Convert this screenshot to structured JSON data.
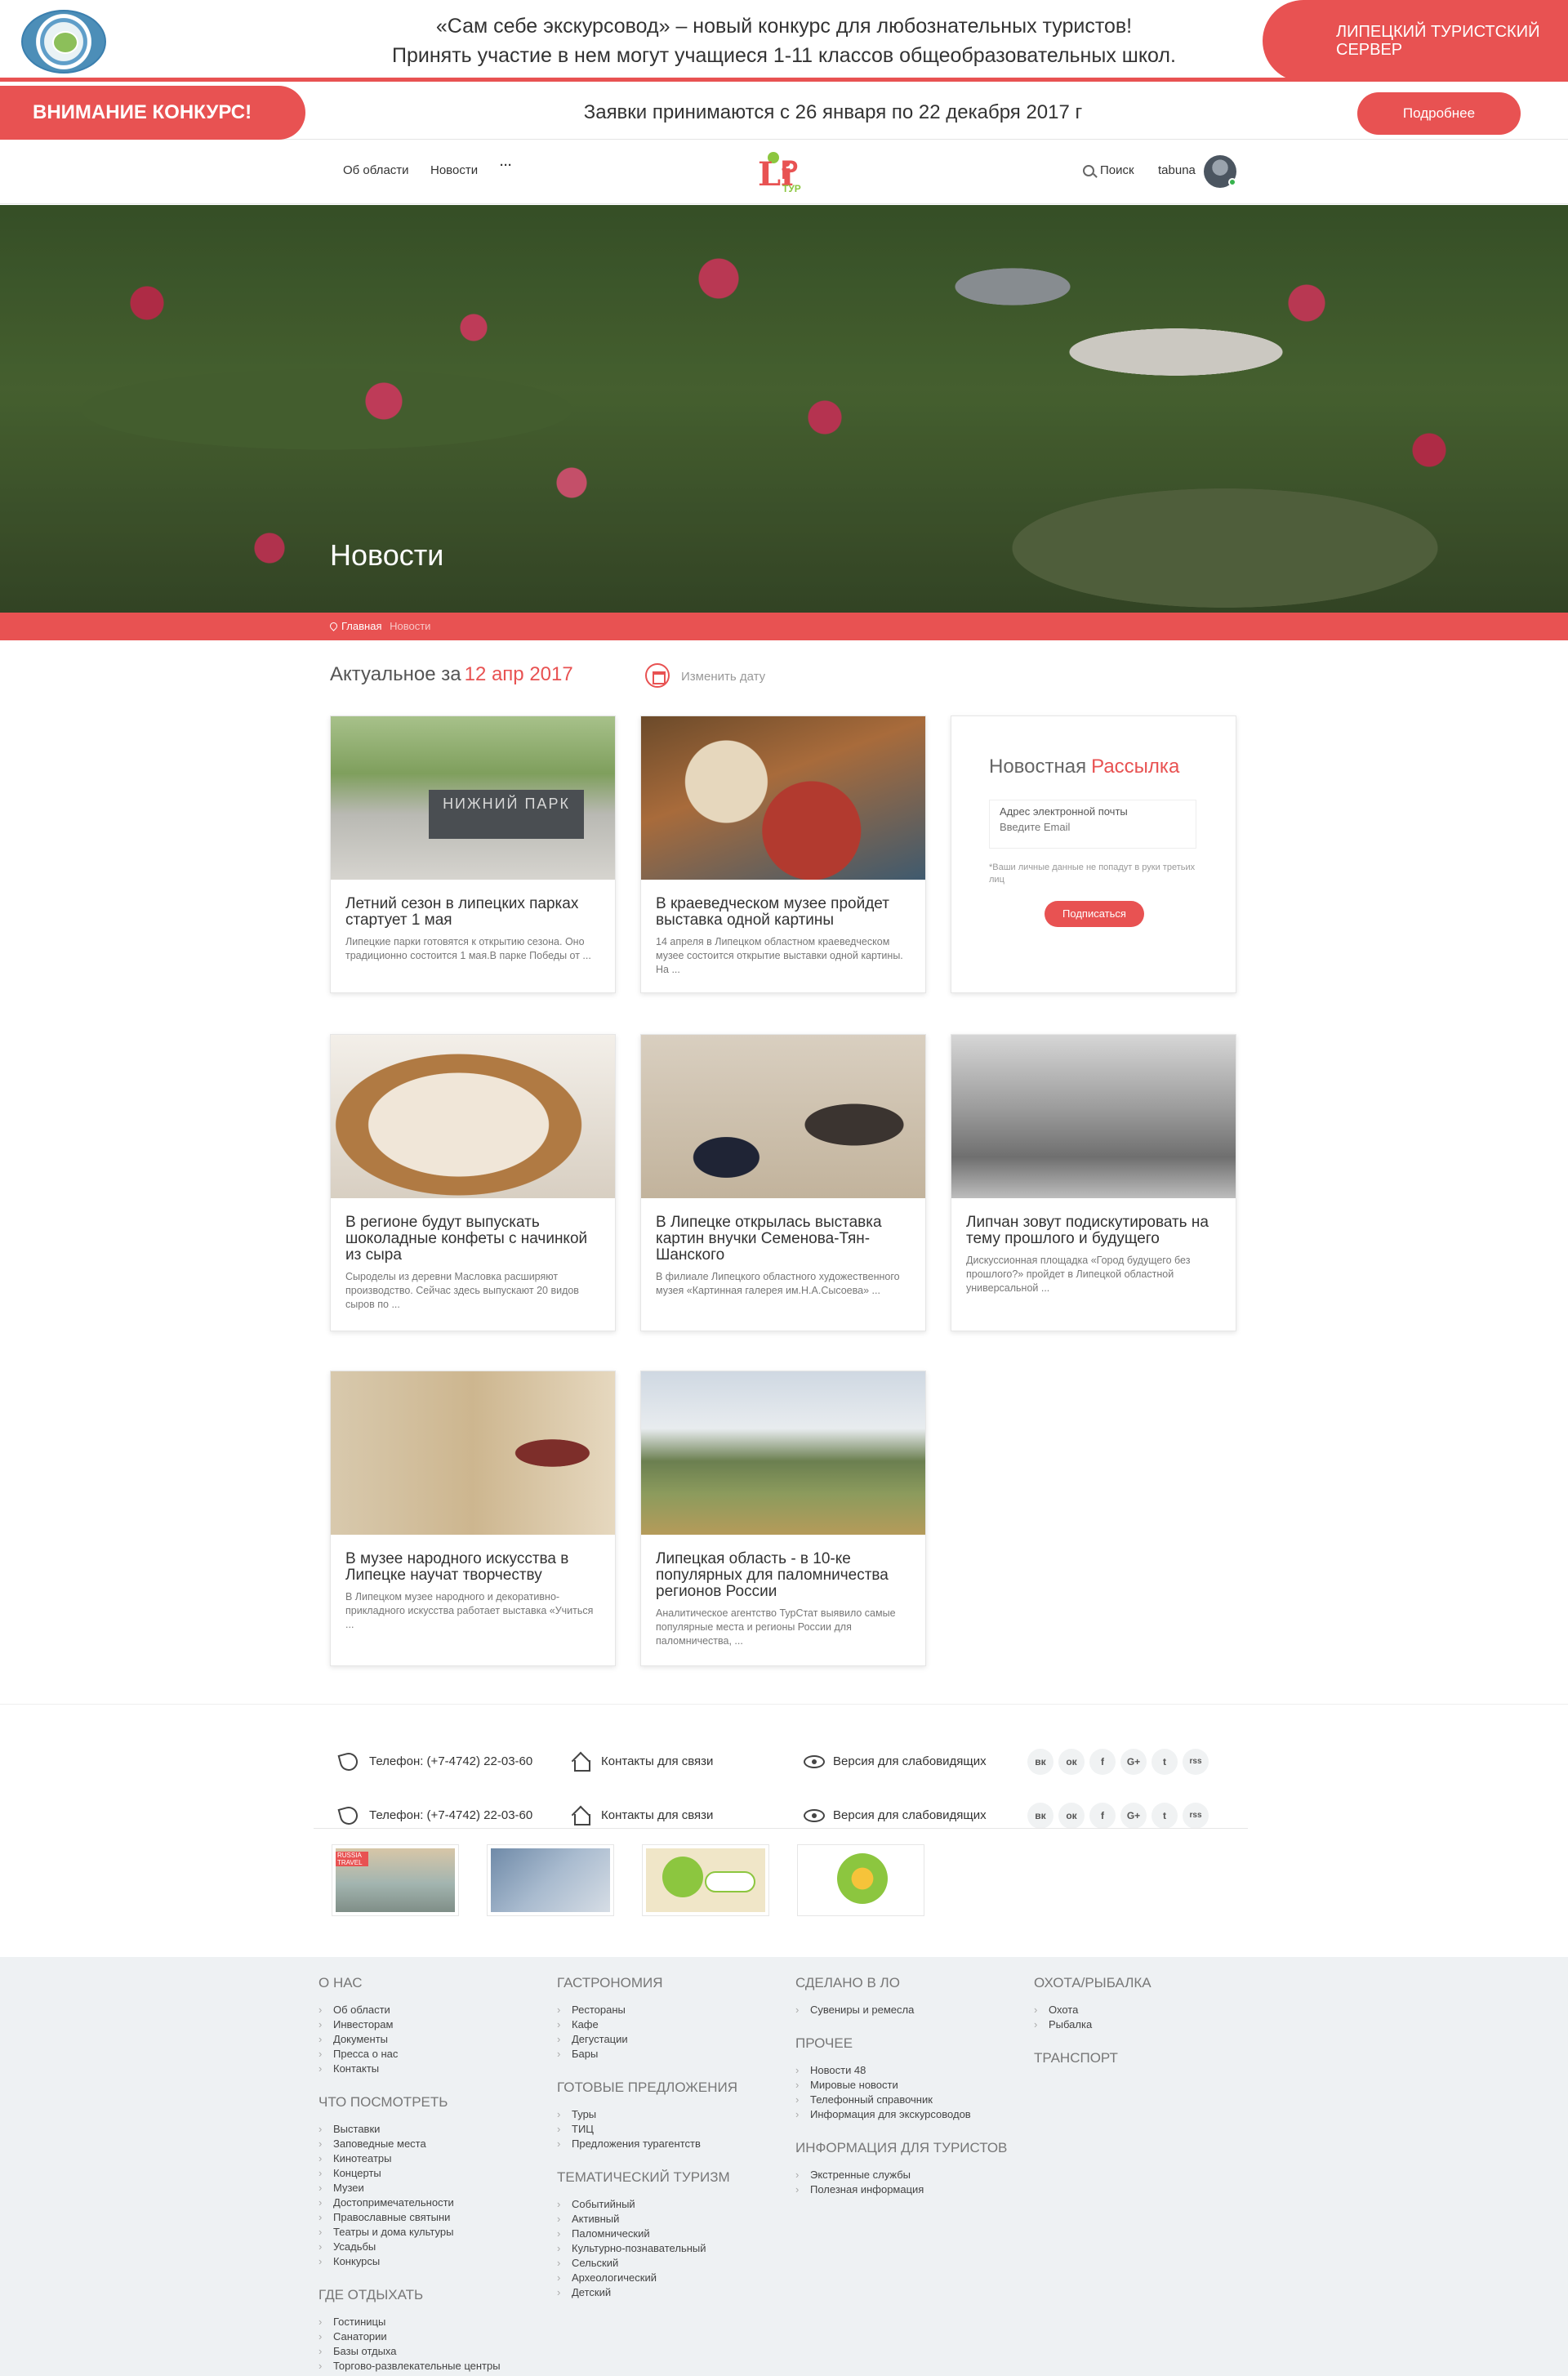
{
  "announcement": {
    "line1": "«Сам себе экскурсовод» – новый конкурс для любознательных туристов!",
    "line2": "Принять участие в нем могут учащиеся 1-11 классов общеобразовательных школ.",
    "server": "ЛИПЕЦКИЙ ТУРИСТСКИЙ СЕРВЕР"
  },
  "contest": {
    "label": "ВНИМАНИЕ КОНКУРС!",
    "text": "Заявки принимаются с 26 января по 22 декабря 2017 г",
    "more": "Подробнее"
  },
  "nav": {
    "about": "Об области",
    "news": "Новости",
    "more": "···",
    "logo_l": "Li",
    "logo_p": "P",
    "logo_tur": "ТУР",
    "search": "Поиск",
    "user": "tabuna"
  },
  "hero": {
    "title": "Новости",
    "crumb_home": "Главная",
    "crumb_current": "Новости"
  },
  "section": {
    "prefix": "Актуальное за",
    "date": "12 апр 2017",
    "change_date": "Изменить дату"
  },
  "cards": [
    {
      "title": "Летний сезон в липецких парках стартует 1 мая",
      "text": "Липецкие парки готовятся к открытию сезона. Оно традиционно состоится 1 мая.В парке Победы от ...",
      "sign": "НИЖНИЙ ПАРК"
    },
    {
      "title": "В краеведческом музее пройдет выставка одной картины",
      "text": "14 апреля в Липецком областном краеведческом музее состоится открытие выставки одной картины. На ..."
    },
    {
      "title": "В регионе будут выпускать шоколадные конфеты с начинкой из сыра",
      "text": "Сыроделы из деревни Масловка расширяют производство. Сейчас здесь выпускают 20 видов сыров по ..."
    },
    {
      "title": "В Липецке открылась выставка картин внучки Семенова-Тян-Шанского",
      "text": "В филиале Липецкого областного художественного музея «Картинная галерея им.Н.А.Сысоева» ..."
    },
    {
      "title": "Липчан зовут подискутировать на тему прошлого и будущего",
      "text": "Дискуссионная площадка «Город будущего без прошлого?» пройдет в Липецкой областной универсальной ..."
    },
    {
      "title": "В музее народного искусства в Липецке научат творчеству",
      "text": "В Липецком музее народного и декоративно-прикладного искусства работает выставка «Учиться ..."
    },
    {
      "title": "Липецкая область - в 10-ке популярных для паломничества регионов России",
      "text": "Аналитическое агентство ТурСтат выявило самые популярные места и регионы России для паломничества, ..."
    }
  ],
  "newsletter": {
    "title": "Новостная",
    "accent": "Рассылка",
    "label": "Адрес электронной почты",
    "placeholder": "Введите Email",
    "note": "*Ваши личные данные не попадут в руки третьих лиц",
    "button": "Подписаться"
  },
  "contacts": {
    "phone": "Телефон: (+7-4742) 22-03-60",
    "contacts": "Контакты для связи",
    "accessible": "Версия для слабовидящих",
    "social": [
      "вк",
      "ок",
      "f",
      "G+",
      "t",
      "rss"
    ]
  },
  "banners": {
    "russia_travel": "RUSSIA TRAVEL"
  },
  "footer": {
    "col1": [
      {
        "heading": "О НАС",
        "items": [
          "Об области",
          "Инвесторам",
          "Документы",
          "Пресса о нас",
          "Контакты"
        ]
      },
      {
        "heading": "ЧТО ПОСМОТРЕТЬ",
        "items": [
          "Выставки",
          "Заповедные места",
          "Кинотеатры",
          "Концерты",
          "Музеи",
          "Достопримечательности",
          "Православные святыни",
          "Театры и дома культуры",
          "Усадьбы",
          "Конкурсы"
        ]
      },
      {
        "heading": "ГДЕ ОТДЫХАТЬ",
        "items": [
          "Гостиницы",
          "Санатории",
          "Базы отдыха",
          "Торгово-развлекательные центры"
        ]
      }
    ],
    "col2": [
      {
        "heading": "ГАСТРОНОМИЯ",
        "items": [
          "Рестораны",
          "Кафе",
          "Дегустации",
          "Бары"
        ]
      },
      {
        "heading": "ГОТОВЫЕ ПРЕДЛОЖЕНИЯ",
        "items": [
          "Туры",
          "ТИЦ",
          "Предложения турагентств"
        ]
      },
      {
        "heading": "ТЕМАТИЧЕСКИЙ ТУРИЗМ",
        "items": [
          "Событийный",
          "Активный",
          "Паломнический",
          "Культурно-познавательный",
          "Сельский",
          "Археологический",
          "Детский"
        ]
      }
    ],
    "col3": [
      {
        "heading": "СДЕЛАНО В ЛО",
        "items": [
          "Сувениры и ремесла"
        ]
      },
      {
        "heading": "ПРОЧЕЕ",
        "items": [
          "Новости 48",
          "Мировые новости",
          "Телефонный справочник",
          "Информация для экскурсоводов"
        ]
      },
      {
        "heading": "ИНФОРМАЦИЯ ДЛЯ ТУРИСТОВ",
        "items": [
          "Экстренные службы",
          "Полезная информация"
        ]
      }
    ],
    "col4": [
      {
        "heading": "ОХОТА/РЫБАЛКА",
        "items": [
          "Охота",
          "Рыбалка"
        ]
      },
      {
        "heading": "ТРАНСПОРТ",
        "items": []
      }
    ]
  }
}
